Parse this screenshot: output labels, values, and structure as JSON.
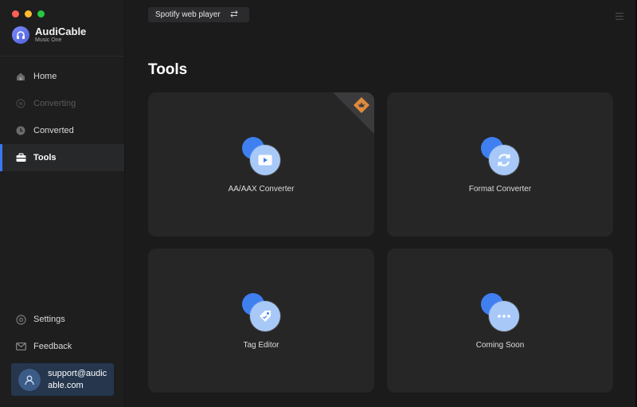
{
  "brand": {
    "name": "AudiCable",
    "subtitle": "Music One"
  },
  "nav": {
    "home": "Home",
    "converting": "Converting",
    "converted": "Converted",
    "tools": "Tools"
  },
  "bottom_nav": {
    "settings": "Settings",
    "feedback": "Feedback"
  },
  "account": {
    "email": "support@audicable.com"
  },
  "topbar": {
    "source_label": "Spotify web player",
    "switch_icon": "swap-icon",
    "menu_icon": "hamburger-icon"
  },
  "page": {
    "title": "Tools"
  },
  "tools": [
    {
      "label": "AA/AAX Converter",
      "icon": "video-play-icon",
      "badge": "pro-crown-icon"
    },
    {
      "label": "Format Converter",
      "icon": "refresh-icon"
    },
    {
      "label": "Tag Editor",
      "icon": "tag-icon"
    },
    {
      "label": "Coming Soon",
      "icon": "more-dots-icon"
    }
  ],
  "colors": {
    "accent": "#3a78f2",
    "badge": "#e08a3c",
    "window_bg": "#1b1b1c",
    "card_bg": "#262627"
  }
}
